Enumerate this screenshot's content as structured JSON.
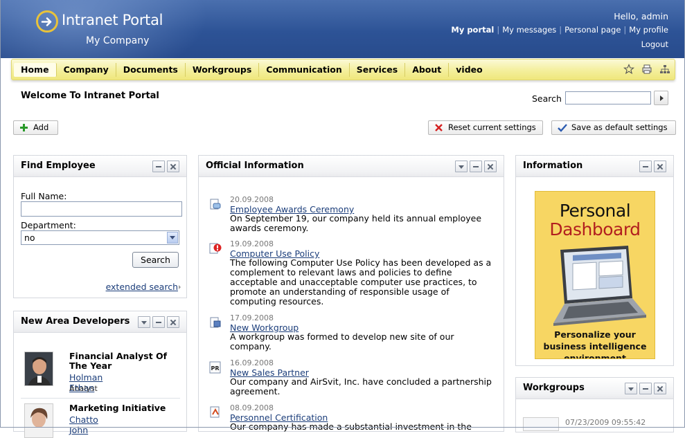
{
  "header": {
    "app_title": "Intranet Portal",
    "company": "My Company",
    "greeting": "Hello, admin",
    "links": [
      "My portal",
      "My messages",
      "Personal page",
      "My profile"
    ],
    "logout": "Logout"
  },
  "nav": {
    "items": [
      "Home",
      "Company",
      "Documents",
      "Workgroups",
      "Communication",
      "Services",
      "About",
      "video"
    ],
    "active": "Home",
    "icons": [
      "star-icon",
      "print-icon",
      "sitemap-icon"
    ]
  },
  "page": {
    "welcome": "Welcome To Intranet Portal",
    "search_label": "Search",
    "search_value": "",
    "add_label": "Add",
    "reset_label": "Reset current settings",
    "save_label": "Save as default settings"
  },
  "find_employee": {
    "title": "Find Employee",
    "full_name_label": "Full Name:",
    "full_name_value": "",
    "department_label": "Department:",
    "department_value": "no",
    "search_button": "Search",
    "extended_search": "extended search"
  },
  "developers": {
    "title": "New Area Developers",
    "items": [
      {
        "role": "Financial Analyst Of The Year",
        "name": "Holman Ethan",
        "position": "Analyst"
      },
      {
        "role": "Marketing Initiative",
        "name": "Chatto John",
        "position": ""
      }
    ]
  },
  "official": {
    "title": "Official Information",
    "items": [
      {
        "date": "20.09.2008",
        "title": "Employee Awards Ceremony",
        "text": "On September 19, our company held its annual employee awards ceremony.",
        "icon": "ceremony-icon"
      },
      {
        "date": "19.09.2008",
        "title": "Computer Use Policy",
        "text": "The following Computer Use Policy has been developed as a complement to relevant laws and policies to define acceptable and unacceptable computer use practices, to promote an understanding of responsible usage of computing resources.",
        "icon": "policy-alert-icon"
      },
      {
        "date": "17.09.2008",
        "title": "New Workgroup",
        "text": "A workgroup was formed to develop new site of our company.",
        "icon": "workgroup-icon"
      },
      {
        "date": "16.09.2008",
        "title": "New Sales Partner",
        "text": "Our company and AirSvit, Inc. have concluded a partnership agreement.",
        "icon": "pr-icon"
      },
      {
        "date": "08.09.2008",
        "title": "Personnel Certification",
        "text": "Our company has made a substantial investment in the",
        "icon": "certificate-icon"
      }
    ]
  },
  "information": {
    "title": "Information",
    "ad_line1": "Personal",
    "ad_line2": "Dashboard",
    "ad_caption": "Personalize your business intelligence environment"
  },
  "workgroups": {
    "title": "Workgroups",
    "first_date": "07/23/2009 09:55:42"
  },
  "colors": {
    "header_blue": "#2d5396",
    "nav_yellow": "#f4ef9c",
    "link": "#1b3d7a",
    "ad_bg": "#f7d663",
    "ad_red": "#b21f1f"
  }
}
